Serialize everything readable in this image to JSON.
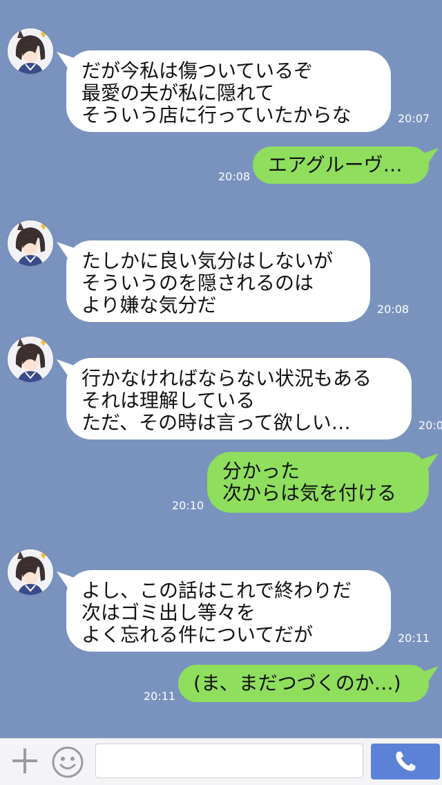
{
  "messages": [
    {
      "side": "in",
      "text": "だが今私は傷ついているぞ\n最愛の夫が私に隠れて\nそういう店に行っていたからな",
      "time": "20:07"
    },
    {
      "side": "out",
      "text": "エアグルーヴ…",
      "time": "20:08"
    },
    {
      "side": "in",
      "text": "たしかに良い気分はしないが\nそういうのを隠されるのは\nより嫌な気分だ",
      "time": "20:08"
    },
    {
      "side": "in",
      "text": "行かなければならない状況もある\nそれは理解している\nただ、その時は言って欲しい…",
      "time": "20:0"
    },
    {
      "side": "out",
      "text": "分かった\n次からは気を付ける",
      "time": "20:10"
    },
    {
      "side": "in",
      "text": "よし、この話はこれで終わりだ\n次はゴミ出し等々を\nよく忘れる件についてだが",
      "time": "20:11"
    },
    {
      "side": "out",
      "text": "(ま、まだつづくのか…)",
      "time": "20:11"
    }
  ],
  "input": {
    "value": "",
    "placeholder": ""
  },
  "icons": {
    "add": "plus-icon",
    "emoji": "smile-icon",
    "call": "phone-icon",
    "avatar": "character-avatar"
  },
  "colors": {
    "background": "#7a93be",
    "incoming": "#ffffff",
    "outgoing": "#8fde5d",
    "call_button": "#5b82d6"
  }
}
